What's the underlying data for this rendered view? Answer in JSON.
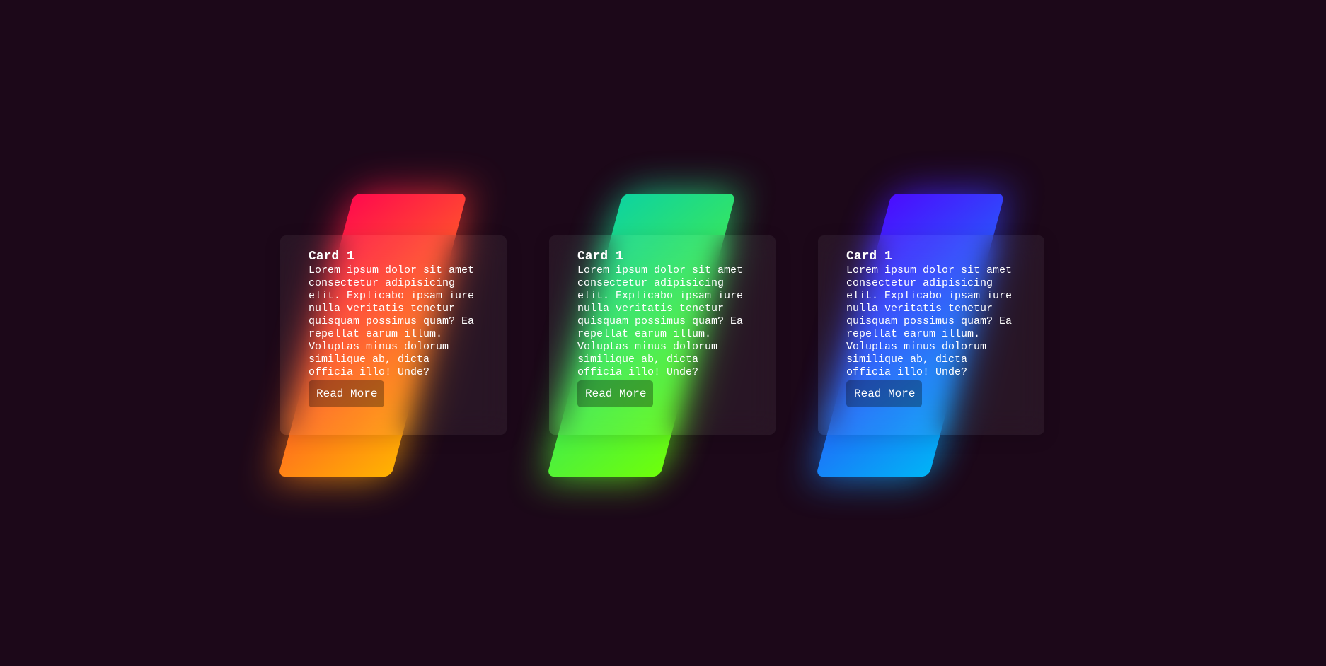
{
  "cards": [
    {
      "title": "Card 1",
      "text": "Lorem ipsum dolor sit amet consectetur adipisicing elit. Explicabo ipsam iure nulla veritatis tenetur quisquam possimus quam? Ea repellat earum illum. Voluptas minus dolorum similique ab, dicta officia illo! Unde?",
      "button": "Read More",
      "gradient_from": "#ff0a4d",
      "gradient_to": "#ffb300"
    },
    {
      "title": "Card 1",
      "text": "Lorem ipsum dolor sit amet consectetur adipisicing elit. Explicabo ipsam iure nulla veritatis tenetur quisquam possimus quam? Ea repellat earum illum. Voluptas minus dolorum similique ab, dicta officia illo! Unde?",
      "button": "Read More",
      "gradient_from": "#0ed39f",
      "gradient_to": "#6eff0a"
    },
    {
      "title": "Card 1",
      "text": "Lorem ipsum dolor sit amet consectetur adipisicing elit. Explicabo ipsam iure nulla veritatis tenetur quisquam possimus quam? Ea repellat earum illum. Voluptas minus dolorum similique ab, dicta officia illo! Unde?",
      "button": "Read More",
      "gradient_from": "#4b0cff",
      "gradient_to": "#00b4f5"
    }
  ],
  "background": "#1c0819"
}
